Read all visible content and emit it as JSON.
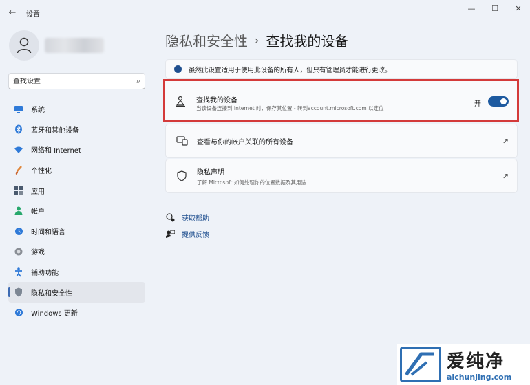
{
  "app": {
    "title": "设置",
    "back": "←",
    "controls": {
      "minimize": "—",
      "maximize": "☐",
      "close": "✕"
    }
  },
  "search": {
    "placeholder": "查找设置",
    "icon": "search-icon"
  },
  "nav": [
    {
      "label": "系统",
      "icon": "monitor-icon",
      "color": "#2f7ad8"
    },
    {
      "label": "蓝牙和其他设备",
      "icon": "bluetooth-icon",
      "color": "#2f7ad8"
    },
    {
      "label": "网络和 Internet",
      "icon": "wifi-icon",
      "color": "#2f7ad8"
    },
    {
      "label": "个性化",
      "icon": "brush-icon",
      "color": "#e0863a"
    },
    {
      "label": "应用",
      "icon": "apps-icon",
      "color": "#4a5a6e"
    },
    {
      "label": "帐户",
      "icon": "person-icon",
      "color": "#27a86c"
    },
    {
      "label": "时间和语言",
      "icon": "globe-clock-icon",
      "color": "#2f7ad8"
    },
    {
      "label": "游戏",
      "icon": "gamepad-icon",
      "color": "#6b6b6b"
    },
    {
      "label": "辅助功能",
      "icon": "accessibility-icon",
      "color": "#2f7ad8"
    },
    {
      "label": "隐私和安全性",
      "icon": "shield-icon",
      "color": "#7d8794",
      "active": true
    },
    {
      "label": "Windows 更新",
      "icon": "update-icon",
      "color": "#2f7ad8"
    }
  ],
  "breadcrumb": {
    "parent": "隐私和安全性",
    "separator": "›",
    "current": "查找我的设备"
  },
  "info": {
    "text": "虽然此设置适用于使用此设备的所有人，但只有管理员才能进行更改。",
    "icon": "info-icon"
  },
  "find_device": {
    "title": "查找我的设备",
    "description": "当该设备连接到 Internet 时，保存其位置 - 转到account.microsoft.com 以定位",
    "toggle_label": "开",
    "toggle_on": true,
    "icon": "location-person-icon"
  },
  "devices": {
    "label": "查看与你的帐户关联的所有设备",
    "icon": "devices-icon",
    "ext_icon": "external-link-icon"
  },
  "privacy": {
    "label": "隐私声明",
    "sub": "了解 Microsoft 如何处理你的位置数据及其用途",
    "icon": "shield-outline-icon",
    "ext_icon": "external-link-icon"
  },
  "links": {
    "help": "获取帮助",
    "feedback": "提供反馈"
  },
  "watermark": {
    "brand": "爱纯净",
    "url": "aichunjing.com"
  }
}
